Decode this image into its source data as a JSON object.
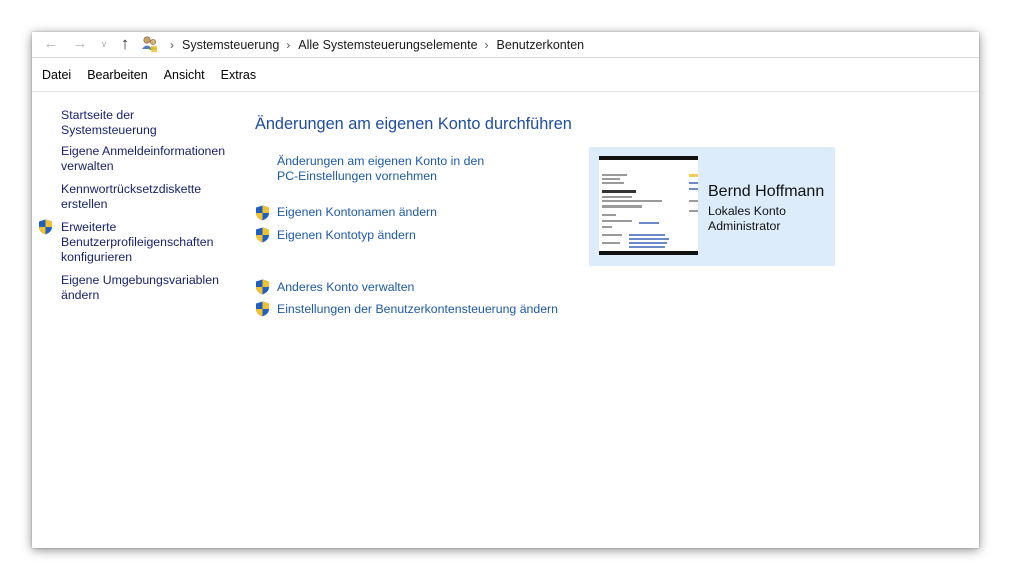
{
  "breadcrumb": [
    "Systemsteuerung",
    "Alle Systemsteuerungselemente",
    "Benutzerkonten"
  ],
  "icons": {
    "back": "arrow-left-icon",
    "forward": "arrow-right-icon",
    "recent": "chevron-down-icon",
    "up": "arrow-up-icon",
    "location": "user-accounts-icon",
    "shield": "uac-shield-icon"
  },
  "menu": [
    "Datei",
    "Bearbeiten",
    "Ansicht",
    "Extras"
  ],
  "left_pane": {
    "home": "Startseite der Systemsteuerung",
    "credentials_1": "Eigene Anmeldeinformationen",
    "credentials_2": "verwalten",
    "reset_disk_1": "Kennwortrücksetzdiskette",
    "reset_disk_2": "erstellen",
    "advanced_1": "Erweiterte",
    "advanced_2": "Benutzerprofileigenschaften",
    "advanced_3": "konfigurieren",
    "env_1": "Eigene Umgebungsvariablen",
    "env_2": "ändern"
  },
  "main": {
    "title": "Änderungen am eigenen Konto durchführen",
    "pc_settings_1": "Änderungen am eigenen Konto in den",
    "pc_settings_2": "PC-Einstellungen vornehmen",
    "rename": "Eigenen Kontonamen ändern",
    "change_type": "Eigenen Kontotyp ändern",
    "manage_other": "Anderes Konto verwalten",
    "uac_settings": "Einstellungen der Benutzerkontensteuerung ändern"
  },
  "user": {
    "name": "Bernd Hoffmann",
    "account_type": "Lokales Konto",
    "role": "Administrator"
  },
  "colors": {
    "link": "#1d5aa8",
    "title": "#1e4ea0",
    "card_bg": "#dcecfb"
  }
}
